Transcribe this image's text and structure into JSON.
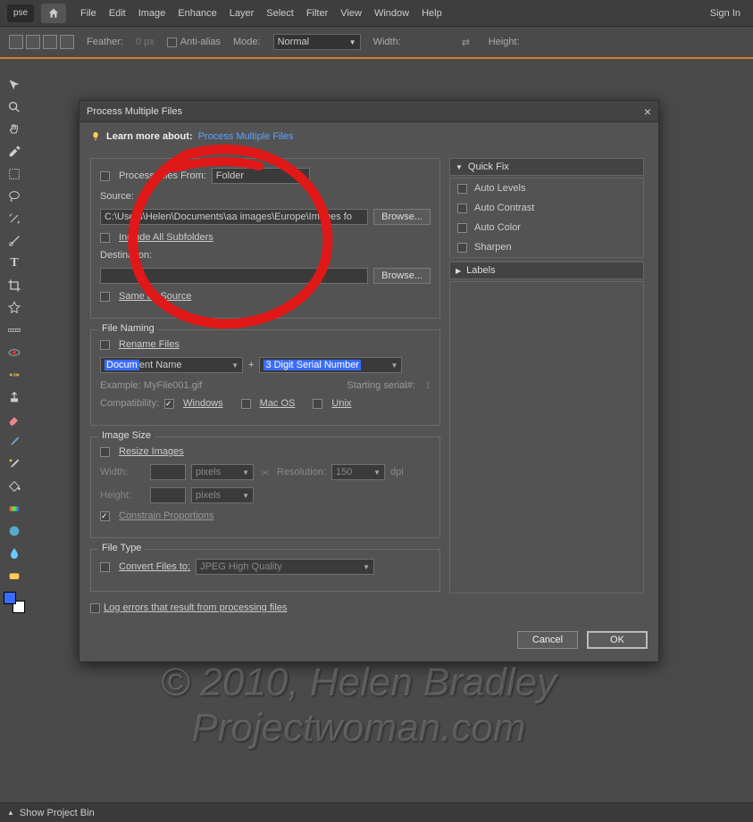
{
  "app": {
    "logo": "pse",
    "signIn": "Sign In"
  },
  "menu": [
    "File",
    "Edit",
    "Image",
    "Enhance",
    "Layer",
    "Select",
    "Filter",
    "View",
    "Window",
    "Help"
  ],
  "options": {
    "featherLabel": "Feather:",
    "featherValue": "0 px",
    "antiAlias": "Anti-alias",
    "modeLabel": "Mode:",
    "modeValue": "Normal",
    "widthLabel": "Width:",
    "heightLabel": "Height:"
  },
  "dialog": {
    "title": "Process Multiple Files",
    "learnLabel": "Learn more about:",
    "learnLink": "Process Multiple Files",
    "processFilesFromLabel": "Process Files From:",
    "processFilesFromValue": "Folder",
    "sourceLabel": "Source:",
    "sourcePath": "C:\\Users\\Helen\\Documents\\aa images\\Europe\\Images fo",
    "browse": "Browse...",
    "includeSubfolders": "Include All Subfolders",
    "destinationLabel": "Destination:",
    "destinationPath": "",
    "sameAsSource": "Same as Source",
    "fileNaming": {
      "legend": "File Naming",
      "rename": "Rename Files",
      "field1Highlight": "Docum",
      "field1Rest": "ent Name",
      "plus": "+",
      "field2": "3 Digit Serial Number",
      "exampleLabel": "Example:",
      "exampleValue": "MyFile001.gif",
      "startingSerialLabel": "Starting serial#:",
      "startingSerialValue": "1",
      "compatLabel": "Compatibility:",
      "compatWindows": "Windows",
      "compatMac": "Mac OS",
      "compatUnix": "Unix"
    },
    "imageSize": {
      "legend": "Image Size",
      "resize": "Resize Images",
      "widthLabel": "Width:",
      "heightLabel": "Height:",
      "unit": "pixels",
      "resolutionLabel": "Resolution:",
      "resolutionValue": "150",
      "resolutionUnit": "dpi",
      "constrain": "Constrain Proportions"
    },
    "fileType": {
      "legend": "File Type",
      "convert": "Convert Files to:",
      "format": "JPEG High Quality"
    },
    "logErrors": "Log errors that result from processing files",
    "quickFix": {
      "header": "Quick Fix",
      "items": [
        "Auto Levels",
        "Auto Contrast",
        "Auto Color",
        "Sharpen"
      ]
    },
    "labels": {
      "header": "Labels"
    },
    "cancel": "Cancel",
    "ok": "OK"
  },
  "watermark": {
    "line1": "© 2010, Helen Bradley",
    "line2": "Projectwoman.com"
  },
  "bottomBar": "Show Project Bin"
}
